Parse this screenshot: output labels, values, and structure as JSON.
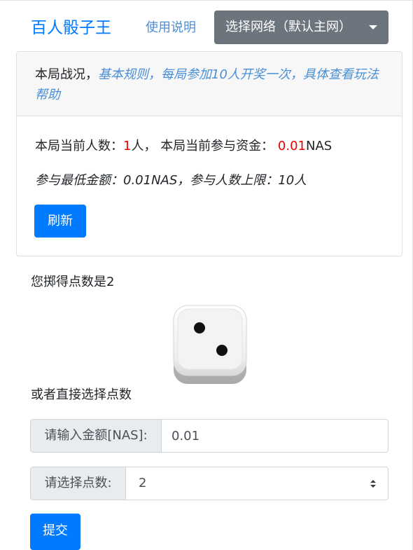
{
  "navbar": {
    "brand": "百人骰子王",
    "help_link": "使用说明",
    "network_button": "选择网络（默认主网）"
  },
  "round_card": {
    "header_prefix": "本局战况，",
    "header_rules": "基本规则，每局参加10人开奖一次，具体查看玩法帮助",
    "stats": {
      "players_label": "本局当前人数：",
      "players_value": "1",
      "players_unit": "人，",
      "funds_label": "本局当前参与资金：",
      "funds_value": "0.01",
      "funds_unit": "NAS"
    },
    "limits": "参与最低金额：0.01NAS，参与人数上限：10人",
    "refresh_button": "刷新"
  },
  "dice": {
    "result_text": "您掷得点数是2",
    "face_value": 2,
    "or_choose_text": "或者直接选择点数"
  },
  "form": {
    "amount_label": "请输入金额[NAS]:",
    "amount_value": "0.01",
    "points_label": "请选择点数:",
    "points_value": "2",
    "submit_button": "提交"
  },
  "colors": {
    "primary": "#007bff",
    "secondary": "#6c757d",
    "highlight": "#ee0000",
    "link": "#4a8fd6"
  }
}
